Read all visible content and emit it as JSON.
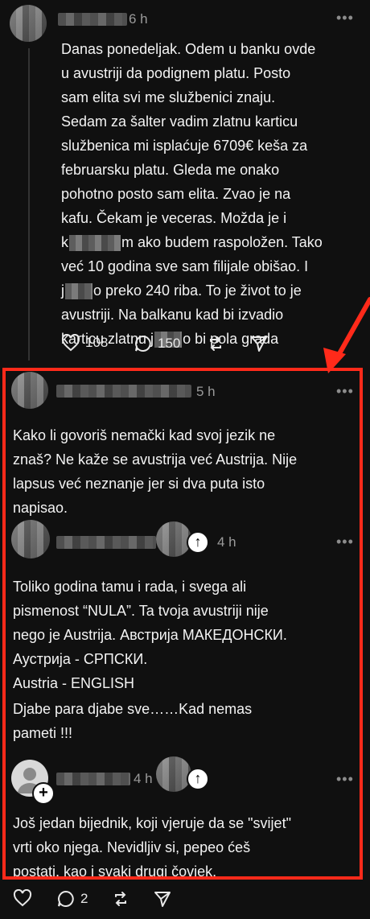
{
  "post": {
    "time": "6 h",
    "text_l1": "Danas ponedeljak. Odem u banku ovde",
    "text_l2": "u avustriji da podignem platu. Posto",
    "text_l3": "sam elita svi me službenici znaju.",
    "text_l4": "Sedam za šalter vadim zlatnu karticu",
    "text_l5": "službenica mi isplaćuje 6709€ keša za",
    "text_l6": "februarsku platu. Gleda me onako",
    "text_l7": "pohotno posto sam elita. Zvao je na",
    "text_l8": "kafu. Čekam je veceras. Možda je i",
    "text_l9a": "k",
    "text_l9b": "m ako budem raspoložen. Tako",
    "text_l10": "već 10 godina sve sam filijale obišao. I",
    "text_l11a": "j",
    "text_l11b": "o preko 240 riba. To je život to je",
    "text_l12": "avustriji. Na balkanu kad bi izvadio",
    "text_l13a": "karticu zlatnu j",
    "text_l13b": "o bi pola grada",
    "likes": "108",
    "comments": "150"
  },
  "reply1": {
    "time": "5 h",
    "text": "Kako li govoriš nemački kad svoj jezik ne\nznaš? Ne kaže se avustrija već Austrija. Nije\nlapsus već neznanje jer si dva puta isto\nnapisao."
  },
  "reply2": {
    "time": "4 h",
    "text": "Toliko godina tamu i rada, i svega ali\npismenost “NULA”. Ta tvoja avustriji nije\nnego je Austrija. Австрија  МАКЕДОНСКИ.\nАустрија - СРПСКИ.\nAustria - ENGLISH",
    "text2": "Djabe para djabe sve……Kad nemas\npameti !!!"
  },
  "reply3": {
    "time": "4 h",
    "text": "Još jedan bijednik, koji vjeruje da se \"svijet\"\nvrti oko njega. Nevidljiv si, pepeo ćeš\npostati, kao i svaki drugi čovjek.",
    "comments": "2"
  },
  "colors": {
    "background": "#101010",
    "annotation": "#ff2a1a",
    "text": "#f3f3f3",
    "muted": "#9a9a9a"
  }
}
